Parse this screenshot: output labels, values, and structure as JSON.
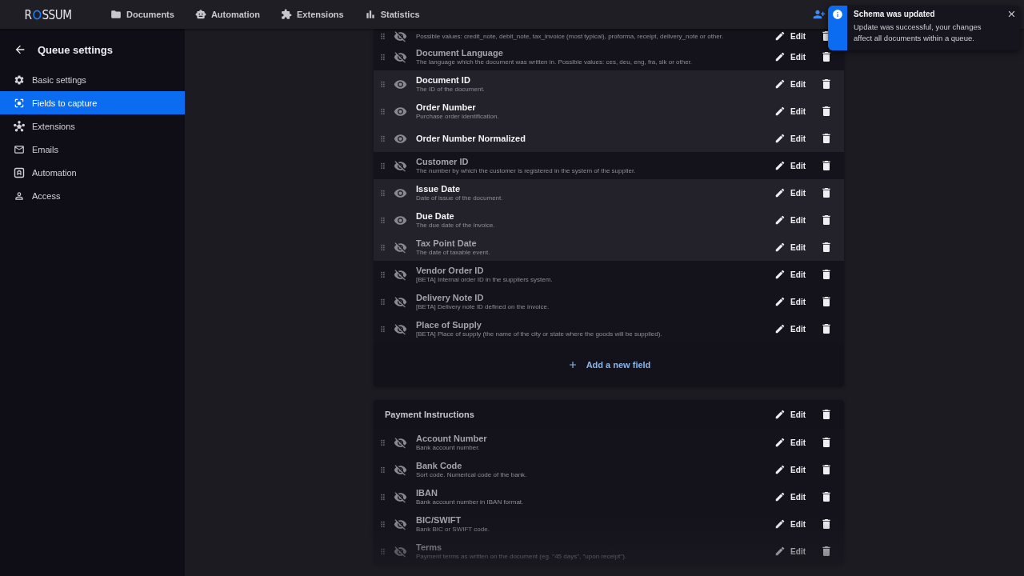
{
  "header": {
    "logo": {
      "before": "R",
      "after": "SSUM"
    },
    "nav": [
      {
        "kind": "folder",
        "label": "Documents"
      },
      {
        "kind": "robot",
        "label": "Automation"
      },
      {
        "kind": "puzzle",
        "label": "Extensions"
      },
      {
        "kind": "bars",
        "label": "Statistics"
      }
    ]
  },
  "sidebar": {
    "title": "Queue settings",
    "items": [
      {
        "kind": "gear",
        "label": "Basic settings",
        "selected": false
      },
      {
        "kind": "focus",
        "label": "Fields to capture",
        "selected": true
      },
      {
        "kind": "nodes",
        "label": "Extensions",
        "selected": false
      },
      {
        "kind": "mail",
        "label": "Emails",
        "selected": false
      },
      {
        "kind": "auto",
        "label": "Automation",
        "selected": false
      },
      {
        "kind": "person",
        "label": "Access",
        "selected": false
      }
    ]
  },
  "sections": [
    {
      "fields": [
        {
          "description": "Possible values: credit_note, debit_note, tax_invoice (most typical), proforma, receipt, delivery_note or other.",
          "visible": false,
          "highlighted": false,
          "edit": "Edit"
        },
        {
          "title": "Document Language",
          "description": "The language which the document was written in. Possible values: ces, deu, eng, fra, slk or other.",
          "visible": false,
          "highlighted": false,
          "edit": "Edit"
        },
        {
          "title": "Document ID",
          "description": "The ID of the document.",
          "visible": true,
          "highlighted": true,
          "edit": "Edit"
        },
        {
          "title": "Order Number",
          "description": "Purchase order identification.",
          "visible": true,
          "highlighted": true,
          "edit": "Edit"
        },
        {
          "title": "Order Number Normalized",
          "visible": true,
          "highlighted": true,
          "edit": "Edit"
        },
        {
          "title": "Customer ID",
          "description": "The number by which the customer is registered in the system of the supplier.",
          "visible": false,
          "highlighted": false,
          "edit": "Edit"
        },
        {
          "title": "Issue Date",
          "description": "Date of issue of the document.",
          "visible": true,
          "highlighted": true,
          "edit": "Edit"
        },
        {
          "title": "Due Date",
          "description": "The due date of the invoice.",
          "visible": true,
          "highlighted": true,
          "edit": "Edit"
        },
        {
          "title": "Tax Point Date",
          "description": "The date of taxable event.",
          "visible": false,
          "highlighted": true,
          "edit": "Edit"
        },
        {
          "title": "Vendor Order ID",
          "description": "[BETA] Internal order ID in the suppliers system.",
          "visible": false,
          "highlighted": false,
          "edit": "Edit"
        },
        {
          "title": "Delivery Note ID",
          "description": "[BETA] Delivery note ID defined on the invoice.",
          "visible": false,
          "highlighted": false,
          "edit": "Edit"
        },
        {
          "title": "Place of Supply",
          "description": "[BETA] Place of supply (the name of the city or state where the goods will be supplied).",
          "visible": false,
          "highlighted": false,
          "edit": "Edit"
        }
      ],
      "add_label": "Add a new field"
    },
    {
      "title": "Payment Instructions",
      "edit": "Edit",
      "fields": [
        {
          "title": "Account Number",
          "description": "Bank account number.",
          "visible": false,
          "highlighted": false,
          "edit": "Edit"
        },
        {
          "title": "Bank Code",
          "description": "Sort code. Numerical code of the bank.",
          "visible": false,
          "highlighted": false,
          "edit": "Edit"
        },
        {
          "title": "IBAN",
          "description": "Bank account number in IBAN format.",
          "visible": false,
          "highlighted": false,
          "edit": "Edit"
        },
        {
          "title": "BIC/SWIFT",
          "description": "Bank BIC or SWIFT code.",
          "visible": false,
          "highlighted": false,
          "edit": "Edit"
        },
        {
          "title": "Terms",
          "description": "Payment terms as written on the document (eg. \"45 days\", \"upon receipt\").",
          "visible": false,
          "highlighted": false,
          "edit": "Edit"
        }
      ]
    }
  ],
  "toast": {
    "title": "Schema was updated",
    "message": "Update was successful, your changes affect all documents within a queue."
  }
}
